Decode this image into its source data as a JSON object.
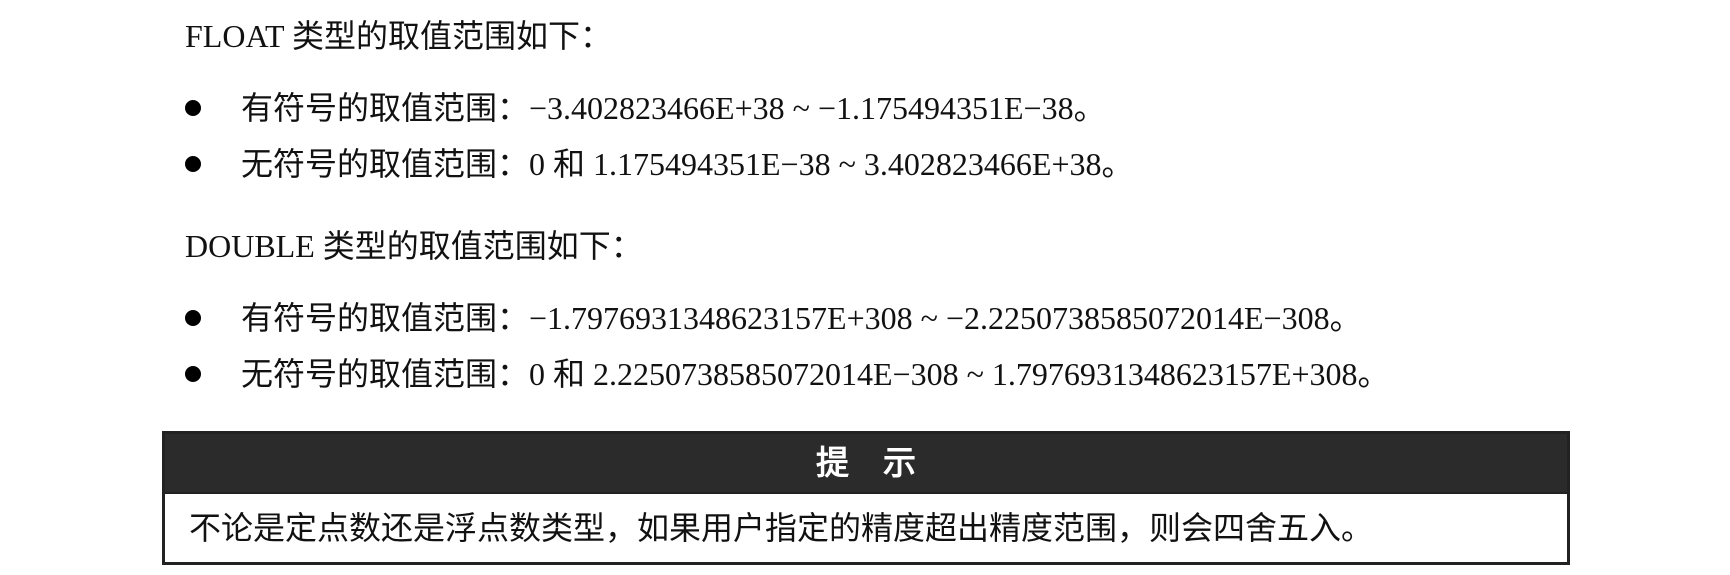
{
  "float_section": {
    "intro": "FLOAT 类型的取值范围如下：",
    "items": [
      "有符号的取值范围：−3.402823466E+38 ~ −1.175494351E−38。",
      "无符号的取值范围：0 和 1.175494351E−38 ~ 3.402823466E+38。"
    ]
  },
  "double_section": {
    "intro": "DOUBLE 类型的取值范围如下：",
    "items": [
      "有符号的取值范围：−1.7976931348623157E+308 ~ −2.2250738585072014E−308。",
      "无符号的取值范围：0 和 2.2250738585072014E−308 ~ 1.7976931348623157E+308。"
    ]
  },
  "tip": {
    "title": "提示",
    "body": "不论是定点数还是浮点数类型，如果用户指定的精度超出精度范围，则会四舍五入。"
  }
}
